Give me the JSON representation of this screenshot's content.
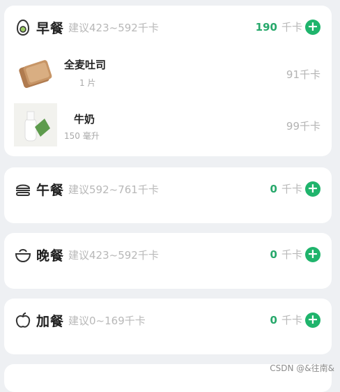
{
  "meals": {
    "breakfast": {
      "title": "早餐",
      "suggestion": "建议423~592千卡",
      "kcal": "190",
      "unit": "千卡",
      "add": "+",
      "foods": [
        {
          "name": "全麦吐司",
          "portion": "1 片",
          "kcal": "91千卡"
        },
        {
          "name": "牛奶",
          "portion": "150 毫升",
          "kcal": "99千卡"
        }
      ]
    },
    "lunch": {
      "title": "午餐",
      "suggestion": "建议592~761千卡",
      "kcal": "0",
      "unit": "千卡",
      "add": "+"
    },
    "dinner": {
      "title": "晚餐",
      "suggestion": "建议423~592千卡",
      "kcal": "0",
      "unit": "千卡",
      "add": "+"
    },
    "snack": {
      "title": "加餐",
      "suggestion": "建议0~169千卡",
      "kcal": "0",
      "unit": "千卡",
      "add": "+"
    }
  },
  "watermark": "CSDN @&往南&",
  "colors": {
    "accent": "#1fb46c",
    "kcal_text": "#27a86b"
  },
  "icons": {
    "breakfast": "avocado-icon",
    "lunch": "burger-icon",
    "dinner": "bowl-icon",
    "snack": "apple-icon",
    "add": "plus-circle-icon"
  }
}
